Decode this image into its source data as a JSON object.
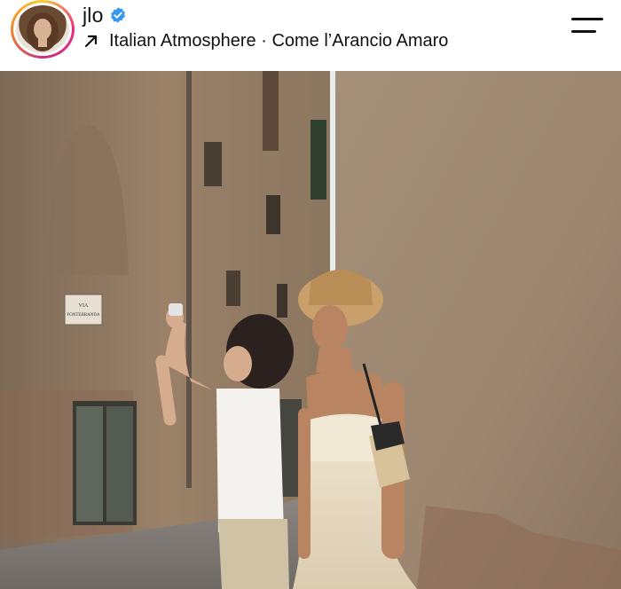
{
  "post": {
    "username": "jlo",
    "verified": true,
    "audio": {
      "artist": "Italian Atmosphere",
      "separator": "·",
      "title": "Come l’Arancio Amaro"
    }
  },
  "icons": {
    "verified": "verified-badge-icon",
    "audio": "arrow-up-right-icon",
    "menu": "hamburger-menu-icon"
  },
  "image": {
    "sign_text": "VIA\nFONTEBRANDA"
  },
  "colors": {
    "verified_blue": "#3897f0",
    "text": "#111111",
    "ring_yellow": "#f9ce34",
    "ring_pink": "#ee2a7b"
  }
}
